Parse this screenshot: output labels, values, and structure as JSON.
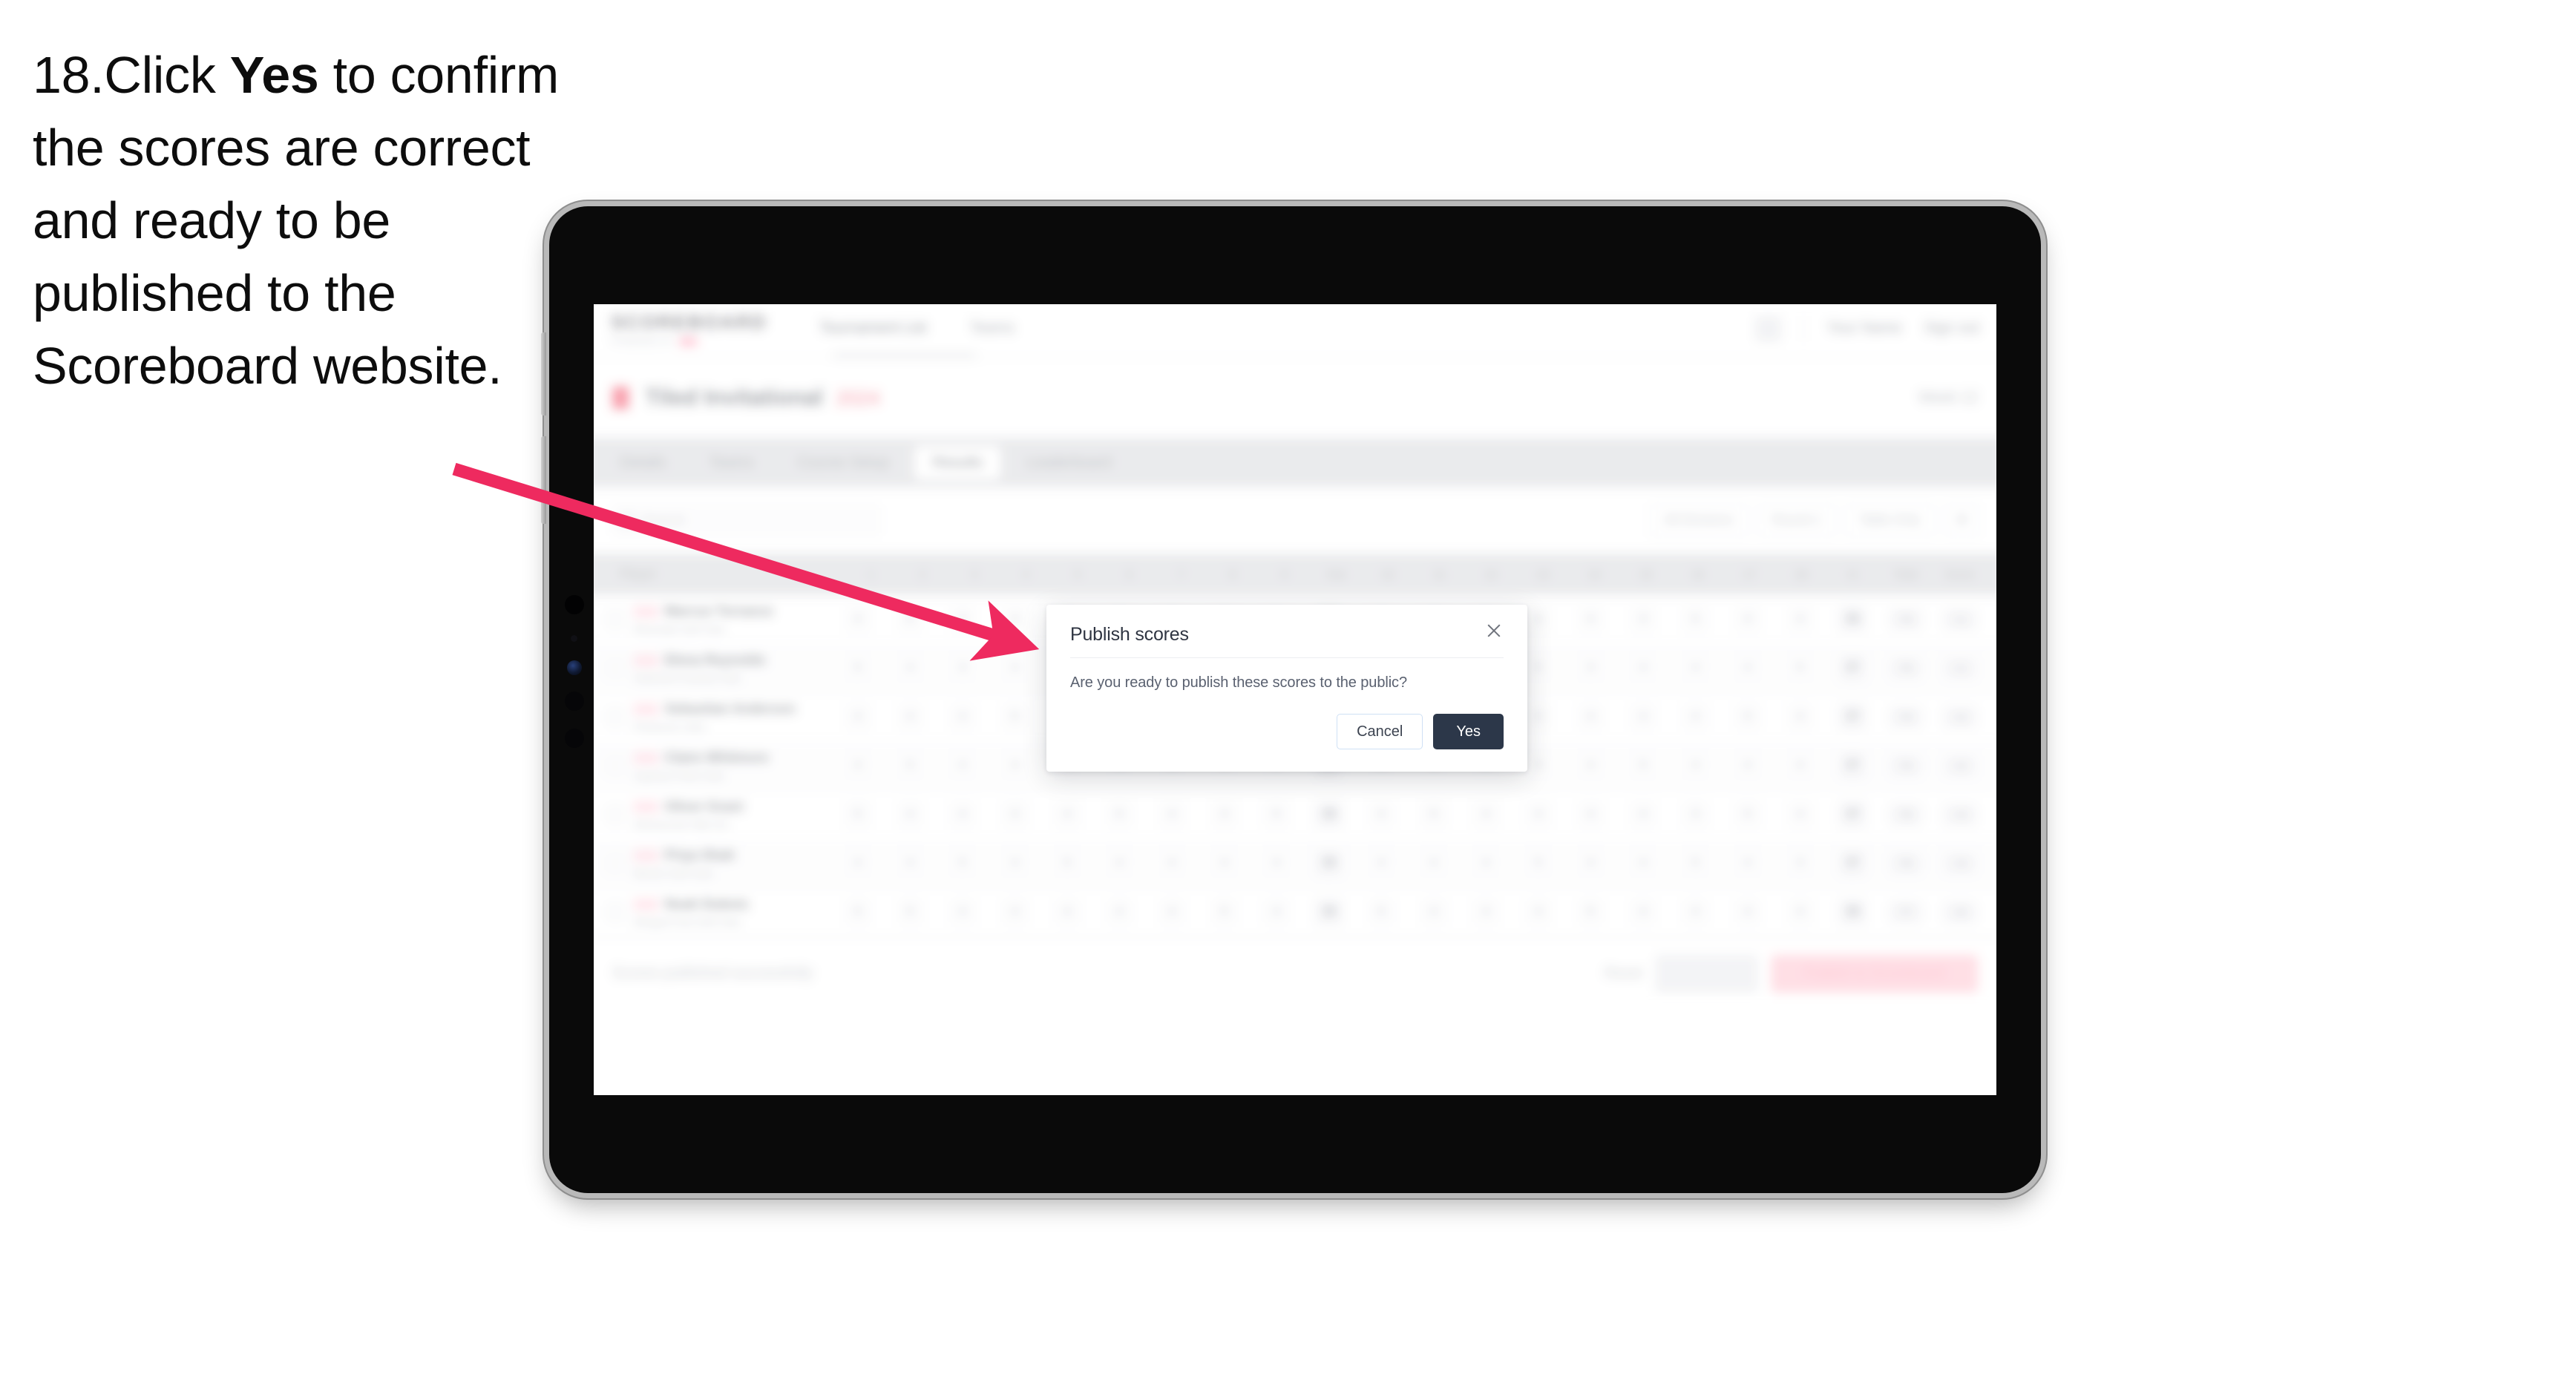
{
  "caption": {
    "number": "18.",
    "part1": "Click ",
    "emphasis": "Yes",
    "part2": " to confirm the scores are correct and ready to be published to the Scoreboard website."
  },
  "colors": {
    "arrow": "#ee2a5f",
    "accent_pink": "#f4455f",
    "primary_dark": "#2c3749",
    "tab_bar": "#d7d8dc"
  },
  "modal": {
    "title": "Publish scores",
    "message": "Are you ready to publish these scores to the public?",
    "cancel_label": "Cancel",
    "confirm_label": "Yes",
    "close_icon": "close-icon"
  },
  "app": {
    "brand": "SCOREBOARD",
    "brand_sub": "POWERED BY",
    "nav_links": [
      "Tournament List",
      "Teams"
    ],
    "nav_right": [
      "Your Name",
      "Sign out"
    ],
    "title": "Tiled Invitational",
    "title_sub": "2024",
    "title_right": "Week 12",
    "tabs": [
      {
        "label": "Details"
      },
      {
        "label": "Teams"
      },
      {
        "label": "Course Setup"
      },
      {
        "label": "Results",
        "active": true
      },
      {
        "label": "Leaderboard"
      }
    ],
    "search_placeholder": "Search",
    "filters": [
      "All Divisions",
      "Round 1",
      "Table Only"
    ],
    "table": {
      "columns": [
        "Player",
        "1",
        "2",
        "3",
        "4",
        "5",
        "6",
        "7",
        "8",
        "9",
        "Out",
        "10",
        "11",
        "12",
        "13",
        "14",
        "15",
        "16",
        "17",
        "18",
        "In",
        "Total",
        "Score"
      ],
      "rows": [
        {
          "badge": "AM",
          "name": "Marcus Torrance",
          "club": "Riverside Golf Club",
          "scores": [
            "4",
            "5",
            "3",
            "4",
            "5",
            "3",
            "4",
            "4",
            "5",
            "37",
            "4",
            "3",
            "5",
            "4",
            "4",
            "3",
            "5",
            "4",
            "4",
            "36"
          ],
          "total": "73",
          "par": "+1",
          "net": "71",
          "pts": "8.5"
        },
        {
          "badge": "PR",
          "name": "Elena Reynolds",
          "club": "Oakmont Country Club",
          "scores": [
            "5",
            "4",
            "3",
            "4",
            "4",
            "4",
            "3",
            "5",
            "4",
            "36",
            "4",
            "4",
            "4",
            "5",
            "3",
            "4",
            "4",
            "4",
            "5",
            "37"
          ],
          "total": "73",
          "par": "+1",
          "net": "72",
          "pts": "8.0"
        },
        {
          "badge": "AM",
          "name": "Sebastian Anderson",
          "club": "Pinehurst Links",
          "scores": [
            "4",
            "4",
            "4",
            "5",
            "4",
            "3",
            "4",
            "4",
            "5",
            "37",
            "5",
            "4",
            "3",
            "4",
            "4",
            "4",
            "4",
            "5",
            "4",
            "37"
          ],
          "total": "74",
          "par": "+2",
          "net": "72",
          "pts": "7.5"
        },
        {
          "badge": "PR",
          "name": "Claire Whitmore",
          "club": "Cypress Point Club",
          "scores": [
            "4",
            "5",
            "4",
            "4",
            "3",
            "4",
            "5",
            "4",
            "4",
            "37",
            "4",
            "4",
            "5",
            "3",
            "4",
            "5",
            "4",
            "4",
            "4",
            "37"
          ],
          "total": "74",
          "par": "+2",
          "net": "73",
          "pts": "7.0"
        },
        {
          "badge": "AM",
          "name": "Oliver Grant",
          "club": "Shinnecock Hills GC",
          "scores": [
            "5",
            "4",
            "4",
            "4",
            "4",
            "5",
            "4",
            "3",
            "5",
            "38",
            "4",
            "5",
            "4",
            "4",
            "4",
            "4",
            "3",
            "5",
            "4",
            "37"
          ],
          "total": "75",
          "par": "+3",
          "net": "73",
          "pts": "6.5"
        },
        {
          "badge": "PR",
          "name": "Priya Shah",
          "club": "Merion Golf Club",
          "scores": [
            "4",
            "4",
            "5",
            "4",
            "5",
            "4",
            "4",
            "4",
            "4",
            "38",
            "4",
            "4",
            "4",
            "5",
            "4",
            "4",
            "5",
            "4",
            "3",
            "37"
          ],
          "total": "75",
          "par": "+3",
          "net": "74",
          "pts": "6.0"
        },
        {
          "badge": "AM",
          "name": "Noah Dubois",
          "club": "Winged Foot Golf Club",
          "scores": [
            "5",
            "5",
            "4",
            "4",
            "4",
            "4",
            "4",
            "5",
            "4",
            "39",
            "5",
            "4",
            "4",
            "4",
            "5",
            "4",
            "4",
            "4",
            "4",
            "38"
          ],
          "total": "77",
          "par": "+5",
          "net": "75",
          "pts": "5.5"
        }
      ]
    },
    "footer": {
      "note": "Scores published successfully",
      "link": "Reset",
      "secondary_button": "Save all",
      "primary_button": "Publish to Scoreboard"
    }
  }
}
